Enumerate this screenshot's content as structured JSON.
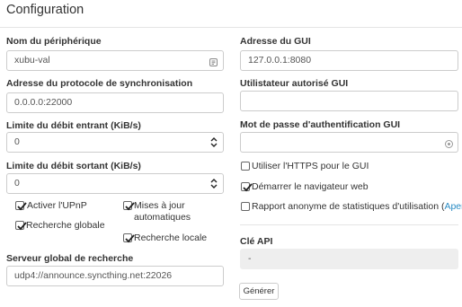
{
  "header": {
    "title": "Configuration"
  },
  "left": {
    "device_name": {
      "label": "Nom du périphérique",
      "value": "xubu-val"
    },
    "sync_protocol": {
      "label": "Adresse du protocole de synchronisation",
      "value": "0.0.0.0:22000"
    },
    "incoming_rate": {
      "label": "Limite du débit entrant (KiB/s)",
      "value": "0"
    },
    "outgoing_rate": {
      "label": "Limite du débit sortant (KiB/s)",
      "value": "0"
    },
    "checkboxes": {
      "upnp": {
        "label": "Activer l'UPnP",
        "checked": true
      },
      "auto_upgrade": {
        "label_line1": "Mises à jour",
        "label_line2": "automatiques",
        "checked": true
      },
      "global_discovery": {
        "label": "Recherche globale",
        "checked": true
      },
      "local_discovery": {
        "label": "Recherche locale",
        "checked": true
      }
    },
    "global_server": {
      "label": "Serveur global de recherche",
      "value": "udp4://announce.syncthing.net:22026"
    }
  },
  "right": {
    "gui_address": {
      "label": "Adresse du GUI",
      "value": "127.0.0.1:8080"
    },
    "gui_user": {
      "label": "Utilistateur autorisé GUI",
      "value": ""
    },
    "gui_password": {
      "label": "Mot de passe d'authentification GUI",
      "value": ""
    },
    "checkboxes": {
      "https": {
        "label": "Utiliser l'HTTPS pour le GUI",
        "checked": false
      },
      "browser": {
        "label": "Démarrer le navigateur web",
        "checked": true
      },
      "stats": {
        "label": "Rapport anonyme de statistiques d'utilisation (",
        "link": "Aperçu",
        "suffix": ")",
        "checked": false
      }
    },
    "api_key": {
      "label": "Clé API",
      "value": "-"
    },
    "generate_button": "Générer"
  },
  "icons": {
    "device_name_field": "id-card-icon",
    "password_field": "key-icon"
  }
}
